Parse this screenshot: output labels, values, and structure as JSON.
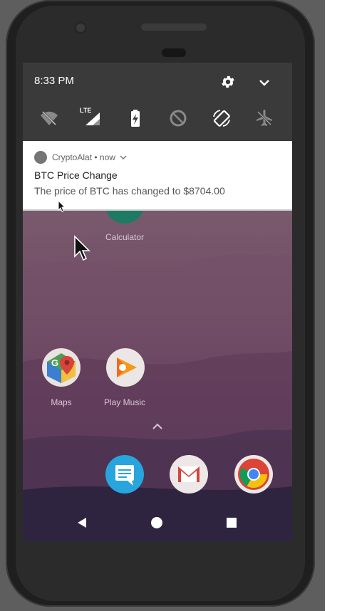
{
  "status_bar": {
    "time": "8:33 PM"
  },
  "quick_settings": {
    "icons": [
      "wifi-off-icon",
      "lte-signal-icon",
      "battery-charging-icon",
      "data-saver-icon",
      "auto-rotate-icon",
      "airplane-mode-icon"
    ],
    "lte_label": "LTE"
  },
  "notification": {
    "app_name": "CryptoAlat",
    "time": "now",
    "title": "BTC Price Change",
    "body": "The price of BTC has changed to $8704.00"
  },
  "home": {
    "apps": [
      {
        "label": "Calculator"
      },
      {
        "label": "Maps"
      },
      {
        "label": "Play Music"
      }
    ]
  },
  "colors": {
    "shade": "#3a3a3a",
    "notification_bg": "#ffffff",
    "wallpaper_top": "#6b5566",
    "wallpaper_bottom": "#2a2036"
  }
}
